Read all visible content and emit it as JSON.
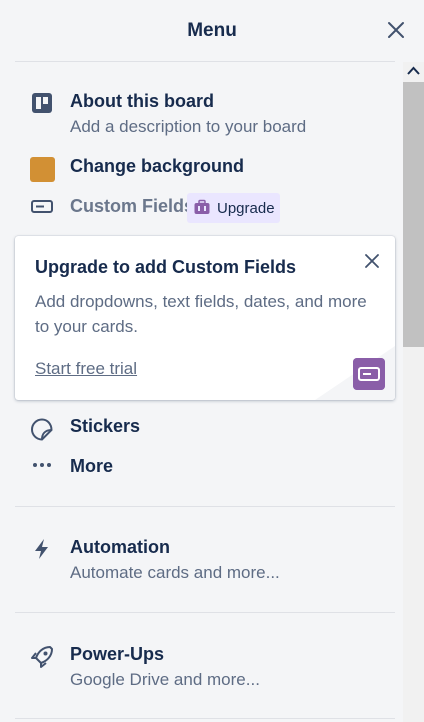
{
  "header": {
    "title": "Menu"
  },
  "items": {
    "about": {
      "title": "About this board",
      "subtitle": "Add a description to your board"
    },
    "background": {
      "title": "Change background",
      "swatch_color": "#d29034"
    },
    "custom_fields": {
      "title": "Custom Fields",
      "badge": "Upgrade"
    },
    "stickers": {
      "title": "Stickers"
    },
    "more": {
      "title": "More"
    },
    "automation": {
      "title": "Automation",
      "subtitle": "Automate cards and more..."
    },
    "powerups": {
      "title": "Power-Ups",
      "subtitle": "Google Drive and more..."
    }
  },
  "promo": {
    "title": "Upgrade to add Custom Fields",
    "body": "Add dropdowns, text fields, dates, and more to your cards.",
    "link": "Start free trial",
    "badge_color": "#8a5ea8"
  },
  "colors": {
    "background": "#f4f5f7",
    "text": "#172b4d",
    "muted": "#5e6c84",
    "upgrade_bg": "#eae6ff"
  }
}
